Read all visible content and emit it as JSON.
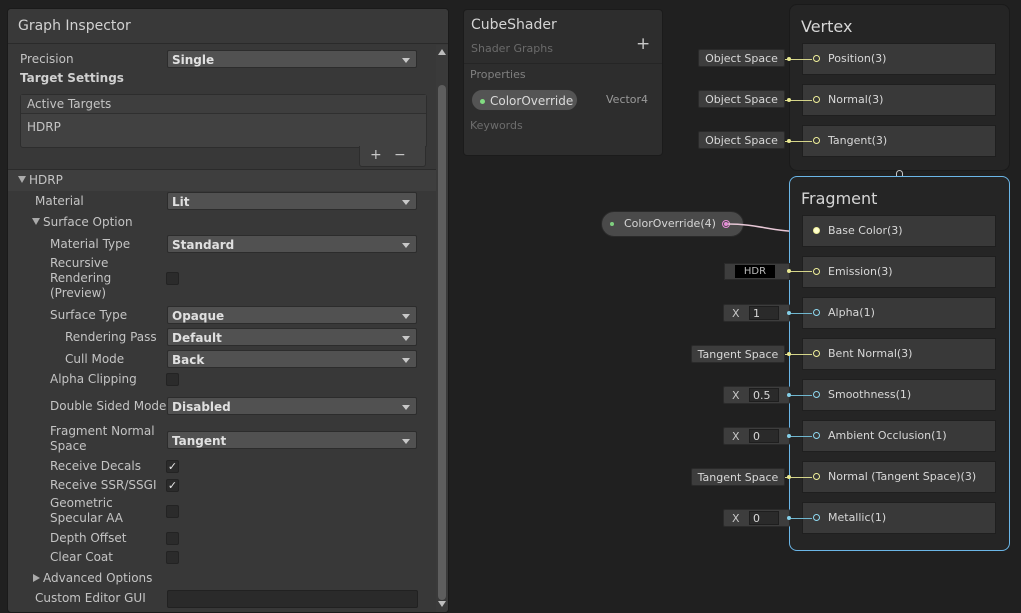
{
  "inspector": {
    "title": "Graph Inspector",
    "precision_label": "Precision",
    "precision_value": "Single",
    "target_settings": "Target Settings",
    "active_targets_header": "Active Targets",
    "active_targets": [
      "HDRP"
    ],
    "add_symbol": "+",
    "remove_symbol": "−",
    "hdrp_section": "HDRP",
    "material_label": "Material",
    "material_value": "Lit",
    "surface_option": "Surface Option",
    "material_type_label": "Material Type",
    "material_type_value": "Standard",
    "recursive_rendering_label": "Recursive Rendering (Preview)",
    "surface_type_label": "Surface Type",
    "surface_type_value": "Opaque",
    "rendering_pass_label": "Rendering Pass",
    "rendering_pass_value": "Default",
    "cull_mode_label": "Cull Mode",
    "cull_mode_value": "Back",
    "alpha_clipping_label": "Alpha Clipping",
    "double_sided_label": "Double Sided Mode",
    "double_sided_value": "Disabled",
    "fragment_normal_label": "Fragment Normal Space",
    "fragment_normal_value": "Tangent",
    "receive_decals_label": "Receive Decals",
    "receive_ssr_label": "Receive SSR/SSGI",
    "geometric_aa_label": "Geometric Specular AA",
    "depth_offset_label": "Depth Offset",
    "clear_coat_label": "Clear Coat",
    "advanced_options": "Advanced Options",
    "custom_editor_label": "Custom Editor GUI",
    "checks": {
      "recursive_rendering": false,
      "alpha_clipping": false,
      "receive_decals": true,
      "receive_ssr": true,
      "geometric_aa": false,
      "depth_offset": false,
      "clear_coat": false
    },
    "check_glyph": "✓"
  },
  "blackboard": {
    "title": "CubeShader",
    "subtitle": "Shader Graphs",
    "add_symbol": "+",
    "properties_label": "Properties",
    "property_name": "ColorOverride",
    "property_type": "Vector4",
    "keywords_label": "Keywords"
  },
  "graph": {
    "property_node": "ColorOverride(4)",
    "vertex": {
      "title": "Vertex",
      "blocks": [
        {
          "name": "Position(3)",
          "input": "Object Space"
        },
        {
          "name": "Normal(3)",
          "input": "Object Space"
        },
        {
          "name": "Tangent(3)",
          "input": "Object Space"
        }
      ]
    },
    "fragment": {
      "title": "Fragment",
      "blocks": [
        {
          "name": "Base Color(3)"
        },
        {
          "name": "Emission(3)",
          "input": "HDR"
        },
        {
          "name": "Alpha(1)",
          "input_axis": "X",
          "input_value": "1"
        },
        {
          "name": "Bent Normal(3)",
          "input": "Tangent Space"
        },
        {
          "name": "Smoothness(1)",
          "input_axis": "X",
          "input_value": "0.5"
        },
        {
          "name": "Ambient Occlusion(1)",
          "input_axis": "X",
          "input_value": "0"
        },
        {
          "name": "Normal (Tangent Space)(3)",
          "input": "Tangent Space"
        },
        {
          "name": "Metallic(1)",
          "input_axis": "X",
          "input_value": "0"
        }
      ]
    },
    "colors": {
      "fragment_border": "#6bb6e7",
      "vector3_port": "#e8e890",
      "float_port": "#84cfe8",
      "vector4_port": "#e48bd5",
      "property_dot": "#82dd82"
    }
  }
}
